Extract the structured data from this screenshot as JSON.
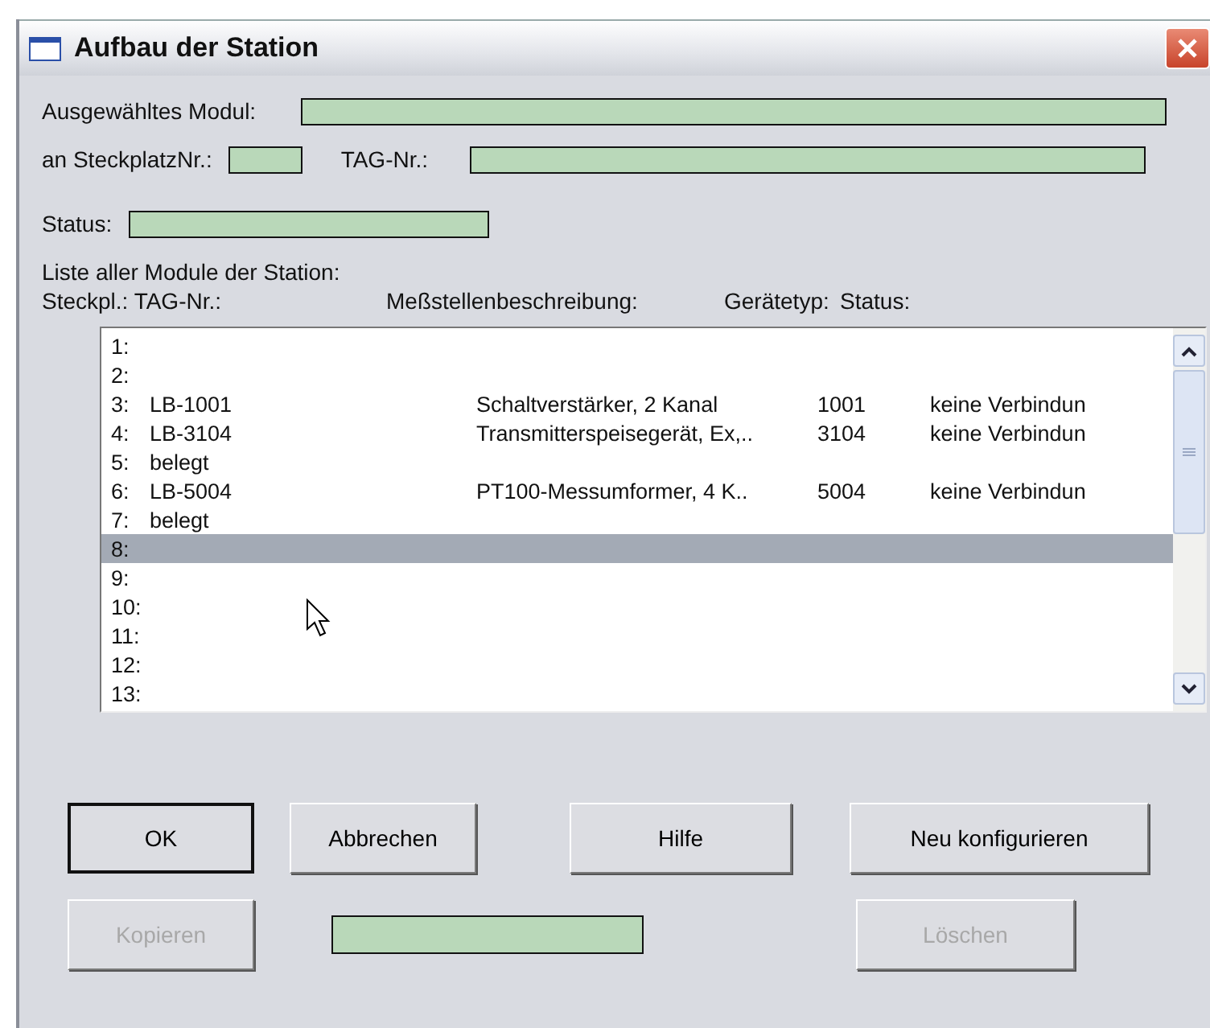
{
  "window": {
    "title": "Aufbau der Station"
  },
  "selected_module": {
    "label": "Ausgewähltes Modul:"
  },
  "slot": {
    "label": "an SteckplatzNr.:"
  },
  "tag": {
    "label": "TAG-Nr.:"
  },
  "status": {
    "label": "Status:"
  },
  "list_title": "Liste aller Module der Station:",
  "columns": [
    "Steckpl.: TAG-Nr.:",
    "Meßstellenbeschreibung:",
    "Gerätetyp:",
    "Status:"
  ],
  "rows": [
    {
      "slot": "1:",
      "tag": "",
      "description": "",
      "device_type": "",
      "status": "",
      "selected": false
    },
    {
      "slot": "2:",
      "tag": "",
      "description": "",
      "device_type": "",
      "status": "",
      "selected": false
    },
    {
      "slot": "3:",
      "tag": "LB-1001",
      "description": "Schaltverstärker, 2 Kanal",
      "device_type": "1001",
      "status": "keine Verbindun",
      "selected": false
    },
    {
      "slot": "4:",
      "tag": "LB-3104",
      "description": "Transmitterspeisegerät, Ex,..",
      "device_type": "3104",
      "status": "keine Verbindun",
      "selected": false
    },
    {
      "slot": "5:",
      "tag": "belegt",
      "description": "",
      "device_type": "",
      "status": "",
      "selected": false
    },
    {
      "slot": "6:",
      "tag": "LB-5004",
      "description": "PT100-Messumformer, 4 K..",
      "device_type": "5004",
      "status": "keine Verbindun",
      "selected": false
    },
    {
      "slot": "7:",
      "tag": "belegt",
      "description": "",
      "device_type": "",
      "status": "",
      "selected": false
    },
    {
      "slot": "8:",
      "tag": "",
      "description": "",
      "device_type": "",
      "status": "",
      "selected": true
    },
    {
      "slot": "9:",
      "tag": "",
      "description": "",
      "device_type": "",
      "status": "",
      "selected": false
    },
    {
      "slot": "10:",
      "tag": "",
      "description": "",
      "device_type": "",
      "status": "",
      "selected": false
    },
    {
      "slot": "11:",
      "tag": "",
      "description": "",
      "device_type": "",
      "status": "",
      "selected": false
    },
    {
      "slot": "12:",
      "tag": "",
      "description": "",
      "device_type": "",
      "status": "",
      "selected": false
    },
    {
      "slot": "13:",
      "tag": "",
      "description": "",
      "device_type": "",
      "status": "",
      "selected": false
    }
  ],
  "buttons": [
    {
      "label": "OK",
      "disabled": false,
      "default": true
    },
    {
      "label": "Abbrechen",
      "disabled": false,
      "default": false
    },
    {
      "label": "Hilfe",
      "disabled": false,
      "default": false
    },
    {
      "label": "Neu konfigurieren",
      "disabled": false,
      "default": false
    },
    {
      "label": "Kopieren",
      "disabled": true,
      "default": false
    },
    {
      "label": "Löschen",
      "disabled": true,
      "default": false
    }
  ]
}
